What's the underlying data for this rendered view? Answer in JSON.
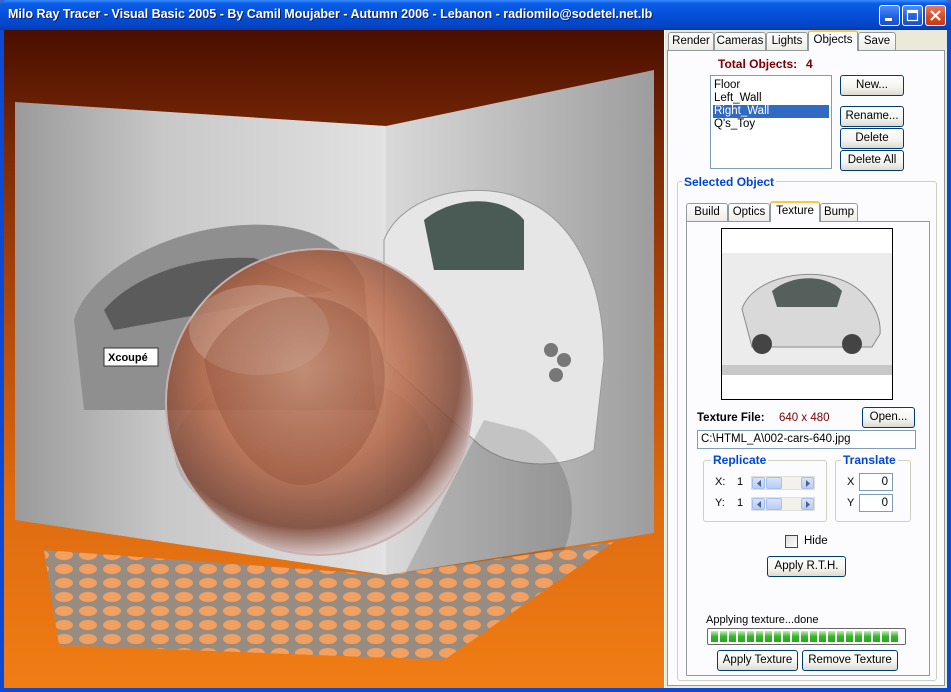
{
  "window": {
    "title": "Milo Ray Tracer - Visual Basic 2005 - By Camil Moujaber - Autumn 2006 - Lebanon - radiomilo@sodetel.net.lb",
    "controls": [
      "minimize-icon",
      "maximize-icon",
      "close-icon"
    ]
  },
  "render": {
    "car_plate_text": "Xcoupé"
  },
  "main_tabs": [
    "Render",
    "Cameras",
    "Lights",
    "Objects",
    "Save"
  ],
  "main_tab_active": "Objects",
  "objects": {
    "total_label": "Total Objects:",
    "total_count": "4",
    "list": [
      "Floor",
      "Left_Wall",
      "Right_Wall",
      "Q's_Toy"
    ],
    "selected": "Right_Wall",
    "new_label": "New...",
    "rename_label": "Rename...",
    "delete_label": "Delete",
    "delete_all_label": "Delete All"
  },
  "selected_object": {
    "title": "Selected Object",
    "tabs": [
      "Build",
      "Optics",
      "Texture",
      "Bump"
    ],
    "active_tab": "Texture"
  },
  "texture": {
    "file_label": "Texture File:",
    "dimensions": "640 x 480",
    "open_label": "Open...",
    "path": "C:\\HTML_A\\002-cars-640.jpg",
    "replicate_title": "Replicate",
    "translate_title": "Translate",
    "rep_x_label": "X:",
    "rep_x_value": "1",
    "rep_y_label": "Y:",
    "rep_y_value": "1",
    "tr_x_label": "X",
    "tr_x_value": "0",
    "tr_y_label": "Y",
    "tr_y_value": "0",
    "hide_label": "Hide",
    "hide_checked": false,
    "apply_rth_label": "Apply R.T.H.",
    "status": "Applying texture...done",
    "progress": 1.0,
    "apply_label": "Apply Texture",
    "remove_label": "Remove Texture"
  },
  "colors": {
    "accent": "#0046d5",
    "total_label": "#7a0000",
    "selection": "#316ac5",
    "progress": "#37b52b",
    "dimensions": "#7a0000"
  }
}
